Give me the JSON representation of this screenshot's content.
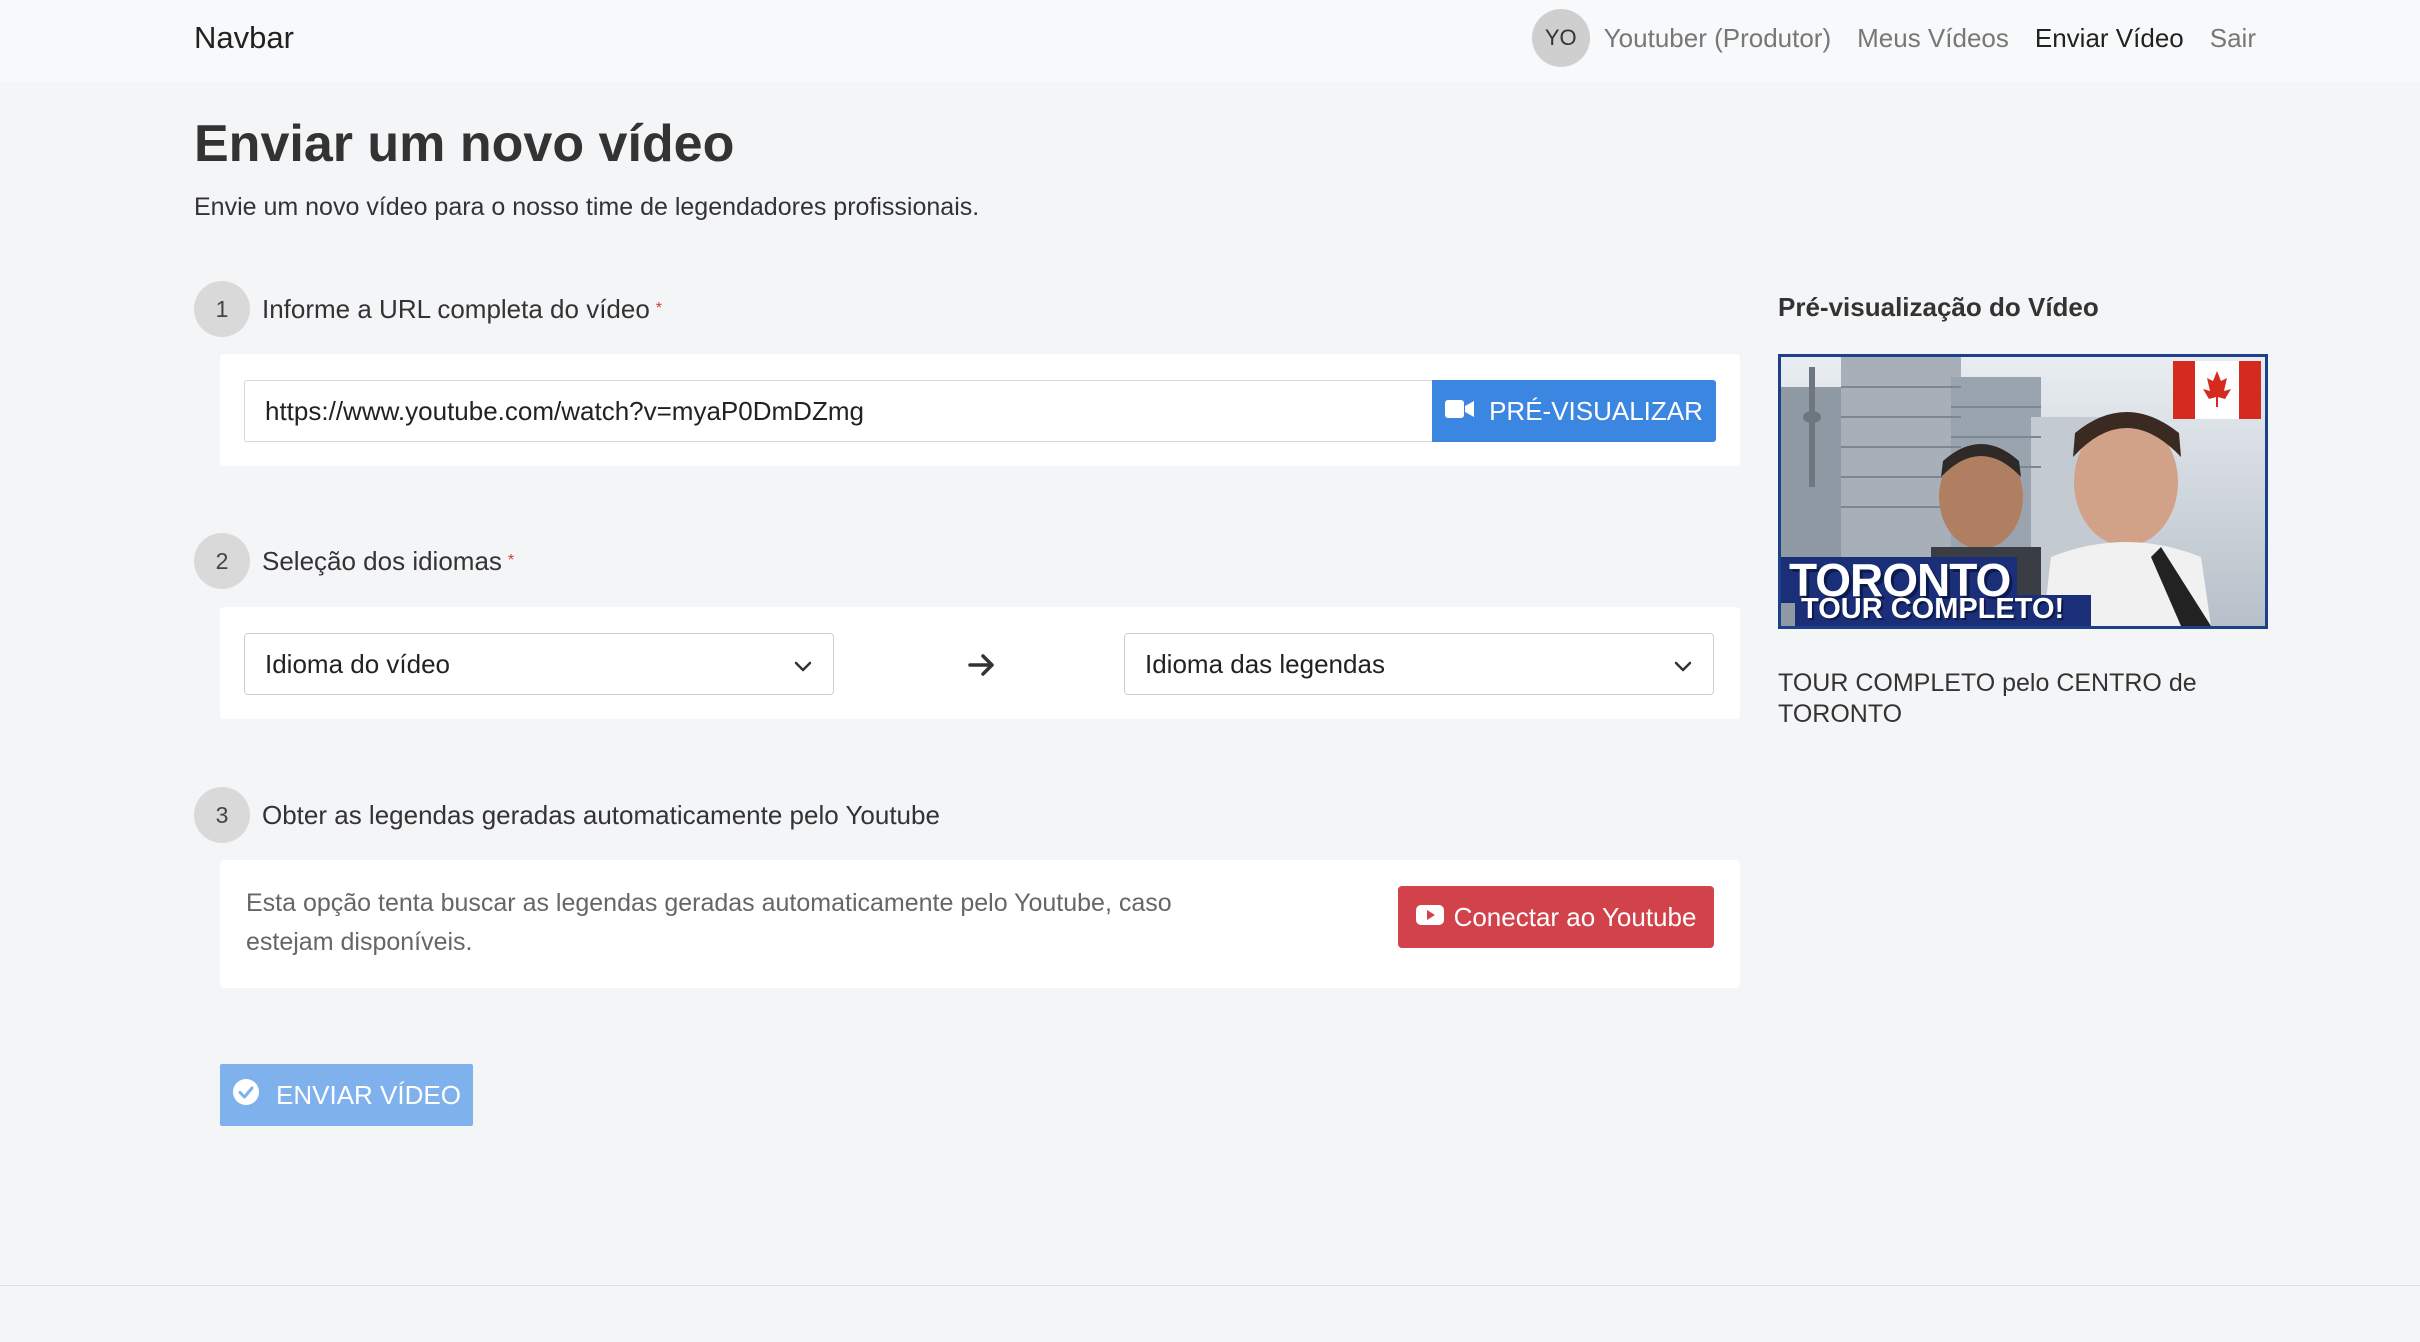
{
  "navbar": {
    "brand": "Navbar",
    "avatar_initials": "YO",
    "user_label": "Youtuber (Produtor)",
    "links": [
      {
        "label": "Meus Vídeos",
        "active": false
      },
      {
        "label": "Enviar Vídeo",
        "active": true
      },
      {
        "label": "Sair",
        "active": false
      }
    ]
  },
  "header": {
    "title": "Enviar um novo vídeo",
    "subtitle": "Envie um novo vídeo para o nosso time de legendadores profissionais."
  },
  "step1": {
    "number": "1",
    "label": "Informe a URL completa do vídeo",
    "required_mark": "*",
    "url_value": "https://www.youtube.com/watch?v=myaP0DmDZmg",
    "preview_button": "PRÉ-VISUALIZAR",
    "preview_icon": "video-camera-icon"
  },
  "step2": {
    "number": "2",
    "label": "Seleção dos idiomas",
    "required_mark": "*",
    "source_select": "Idioma do vídeo",
    "target_select": "Idioma das legendas",
    "arrow_icon": "arrow-right-icon"
  },
  "step3": {
    "number": "3",
    "label": "Obter as legendas geradas automaticamente pelo Youtube",
    "description": "Esta opção tenta buscar as legendas geradas automaticamente pelo Youtube, caso estejam disponíveis.",
    "connect_button": "Conectar ao Youtube",
    "connect_icon": "youtube-icon"
  },
  "submit": {
    "label": "ENVIAR VÍDEO",
    "icon": "check-circle-icon"
  },
  "preview": {
    "title": "Pré-visualização do Vídeo",
    "thumb_line1": "TORONTO",
    "thumb_line2": "TOUR COMPLETO!",
    "caption": "TOUR COMPLETO pelo CENTRO de TORONTO"
  },
  "colors": {
    "primary": "#3a86e0",
    "primary_disabled": "#7fb1ed",
    "youtube_red": "#d1424a",
    "required": "#d33a3a",
    "background": "#f4f5f7"
  }
}
